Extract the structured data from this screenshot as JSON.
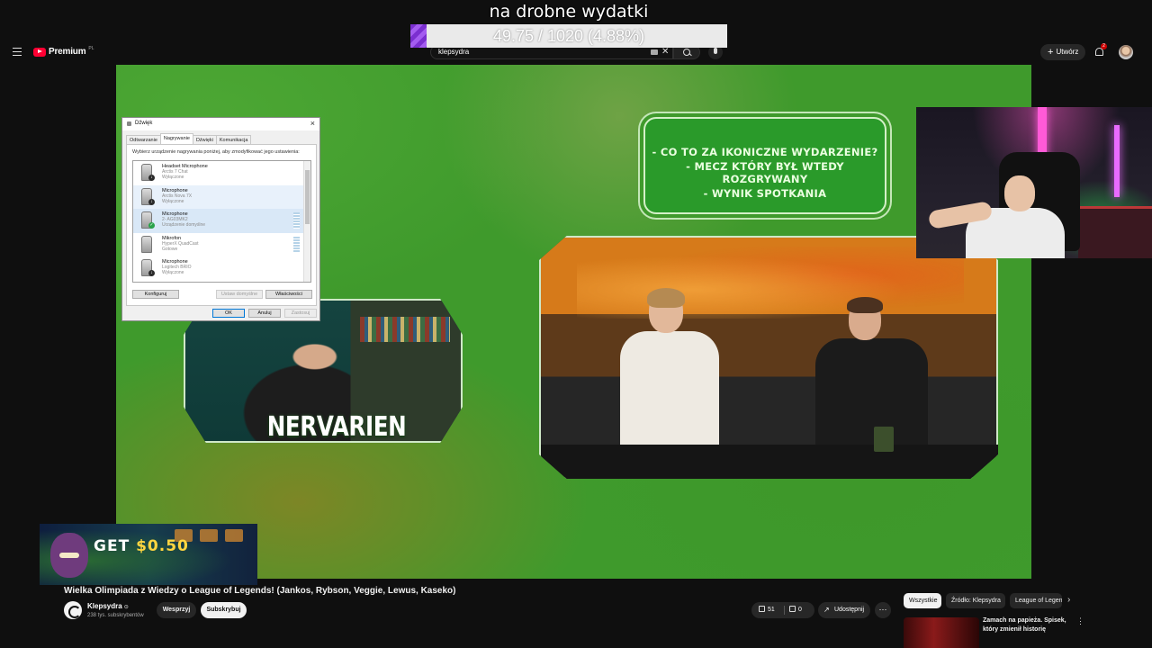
{
  "overlay": {
    "donation_title": "na drobne wydatki",
    "donation_progress_text": "49.75 / 1020 (4.88%)",
    "donation_progress_fraction": 0.0488,
    "bar_fill_color": "#8e45e0"
  },
  "header": {
    "logo_text": "Premium",
    "logo_region": "PL",
    "search_value": "klepsydra",
    "create_label": "Utwórz",
    "notification_count": "2",
    "icons": [
      "menu-icon",
      "keyboard-icon",
      "clear-icon",
      "search-icon",
      "mic-icon",
      "plus-icon",
      "bell-icon",
      "avatar"
    ]
  },
  "video_overlay": {
    "question_lines": [
      "- CO TO ZA IKONICZNE WYDARZENIE?",
      "- MECZ KTÓRY BYŁ WTEDY ROZGRYWANY",
      "- WYNIK SPOTKANIA"
    ],
    "streamer_name": "NERVARIEN"
  },
  "dialog": {
    "title": "Dźwięk",
    "close_glyph": "×",
    "tabs": [
      "Odtwarzanie",
      "Nagrywanie",
      "Dźwięki",
      "Komunikacja"
    ],
    "active_tab": "Nagrywanie",
    "instruction": "Wybierz urządzenie nagrywania poniżej, aby zmodyfikować jego ustawienia:",
    "devices": [
      {
        "name": "Headset Microphone",
        "model": "Arctis 7 Chat",
        "status": "Wyłączone"
      },
      {
        "name": "Microphone",
        "model": "Arctis Nova 7X",
        "status": "Wyłączone"
      },
      {
        "name": "Microphone",
        "model": "2- AG03MK2",
        "status": "Urządzenie domyślne"
      },
      {
        "name": "Mikrofon",
        "model": "HyperX QuadCast",
        "status": "Gotowe"
      },
      {
        "name": "Microphone",
        "model": "Logitech BRIO",
        "status": "Wyłączone"
      }
    ],
    "buttons": {
      "configure": "Konfiguruj",
      "set_default": "Ustaw domyślne",
      "properties": "Właściwości",
      "ok": "OK",
      "cancel": "Anuluj",
      "apply": "Zastosuj"
    }
  },
  "ad": {
    "text_get": "GET",
    "text_amount": "$0.50"
  },
  "below_video": {
    "title": "Wielka Olimpiada z Wiedzy o League of Legends! (Jankos, Rybson, Veggie, Lewus, Kaseko)",
    "channel_name": "Klepsydra",
    "verified_glyph": "⊙",
    "subscribers": "238 tys. subskrybentów",
    "support_label": "Wesprzyj",
    "subscribe_label": "Subskrybuj",
    "likes": "51",
    "dislikes": "0",
    "share_label": "Udostępnij",
    "more_glyph": "⋯"
  },
  "sidebar": {
    "chips": [
      "Wszystkie",
      "Źródło: Klepsydra",
      "League of Legends"
    ],
    "chip_next_glyph": "›",
    "recommendation_title": "Zamach na papieża. Spisek, który zmienił historię",
    "recommendation_more_glyph": "⋮"
  }
}
